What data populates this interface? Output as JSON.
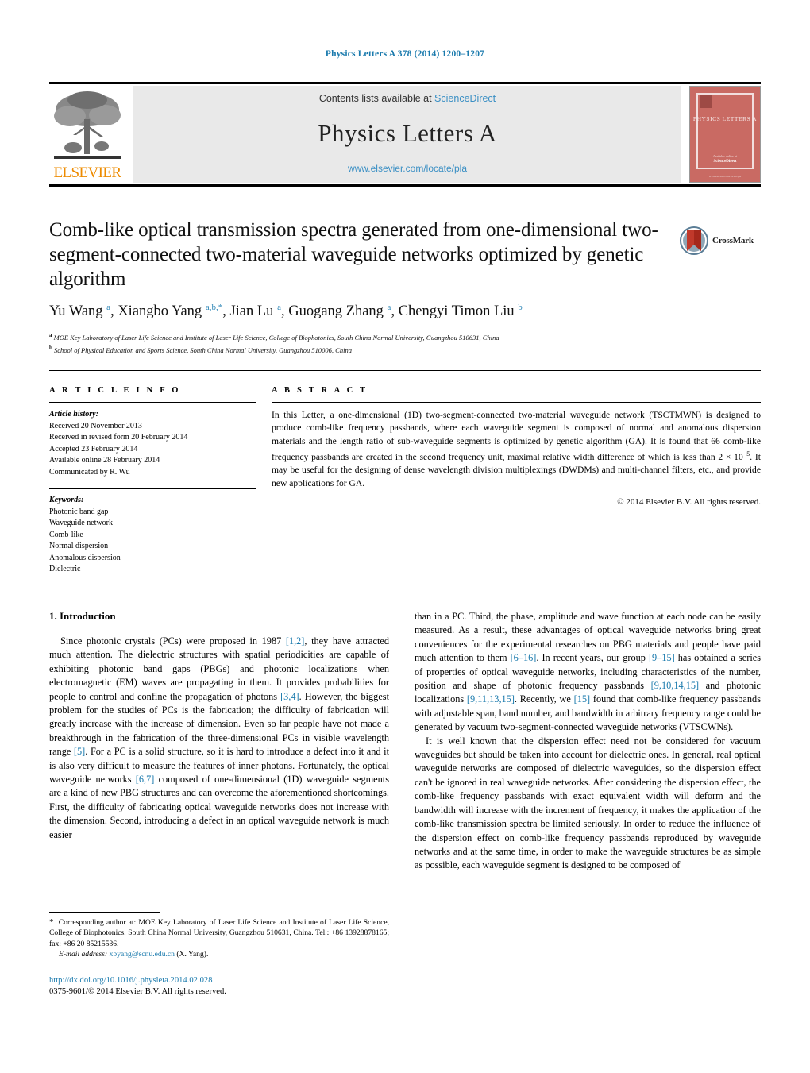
{
  "running_head": "Physics Letters A 378 (2014) 1200–1207",
  "masthead": {
    "contents_prefix": "Contents lists available at ",
    "sciencedirect": "ScienceDirect",
    "journal_title": "Physics Letters A",
    "journal_url": "www.elsevier.com/locate/pla",
    "publisher_wordmark": "ELSEVIER",
    "cover": {
      "title": "PHYSICS LETTERS A",
      "footer_line1": "Available online at",
      "footer_line2": "ScienceDirect",
      "footer_line3": "www.elsevier.com/locate/pla"
    }
  },
  "article": {
    "title": "Comb-like optical transmission spectra generated from one-dimensional two-segment-connected two-material waveguide networks optimized by genetic algorithm",
    "crossmark_label": "CrossMark",
    "authors_html": "Yu Wang <sup>a</sup>, Xiangbo Yang <sup>a,b,</sup><sup>*</sup>, Jian Lu <sup>a</sup>, Guogang Zhang <sup>a</sup>, Chengyi Timon Liu <sup>b</sup>",
    "affiliations": [
      {
        "marker": "a",
        "text": "MOE Key Laboratory of Laser Life Science and Institute of Laser Life Science, College of Biophotonics, South China Normal University, Guangzhou 510631, China"
      },
      {
        "marker": "b",
        "text": "School of Physical Education and Sports Science, South China Normal University, Guangzhou 510006, China"
      }
    ]
  },
  "article_info": {
    "heading": "A R T I C L E   I N F O",
    "history_label": "Article history:",
    "history": [
      "Received 20 November 2013",
      "Received in revised form 20 February 2014",
      "Accepted 23 February 2014",
      "Available online 28 February 2014",
      "Communicated by R. Wu"
    ],
    "keywords_label": "Keywords:",
    "keywords": [
      "Photonic band gap",
      "Waveguide network",
      "Comb-like",
      "Normal dispersion",
      "Anomalous dispersion",
      "Dielectric"
    ]
  },
  "abstract": {
    "heading": "A B S T R A C T",
    "body_html": "In this Letter, a one-dimensional (1D) two-segment-connected two-material waveguide network (TSCTMWN) is designed to produce comb-like frequency passbands, where each waveguide segment is composed of normal and anomalous dispersion materials and the length ratio of sub-waveguide segments is optimized by genetic algorithm (GA). It is found that 66 comb-like frequency passbands are created in the second frequency unit, maximal relative width difference of which is less than 2 × 10<sup>−5</sup>. It may be useful for the designing of dense wavelength division multiplexings (DWDMs) and multi-channel filters, etc., and provide new applications for GA.",
    "copyright": "© 2014 Elsevier B.V. All rights reserved."
  },
  "body": {
    "section_heading": "1. Introduction",
    "left_paragraph_1_html": "Since photonic crystals (PCs) were proposed in 1987 <span class=\"ref\">[1,2]</span>, they have attracted much attention. The dielectric structures with spatial periodicities are capable of exhibiting photonic band gaps (PBGs) and photonic localizations when electromagnetic (EM) waves are propagating in them. It provides probabilities for people to control and confine the propagation of photons <span class=\"ref\">[3,4]</span>. However, the biggest problem for the studies of PCs is the fabrication; the difficulty of fabrication will greatly increase with the increase of dimension. Even so far people have not made a breakthrough in the fabrication of the three-dimensional PCs in visible wavelength range <span class=\"ref\">[5]</span>. For a PC is a solid structure, so it is hard to introduce a defect into it and it is also very difficult to measure the features of inner photons. Fortunately, the optical waveguide networks <span class=\"ref\">[6,7]</span> composed of one-dimensional (1D) waveguide segments are a kind of new PBG structures and can overcome the aforementioned shortcomings. First, the difficulty of fabricating optical waveguide networks does not increase with the dimension. Second, introducing a defect in an optical waveguide network is much easier",
    "right_paragraph_1_html": "than in a PC. Third, the phase, amplitude and wave function at each node can be easily measured. As a result, these advantages of optical waveguide networks bring great conveniences for the experimental researches on PBG materials and people have paid much attention to them <span class=\"ref\">[6–16]</span>. In recent years, our group <span class=\"ref\">[9–15]</span> has obtained a series of properties of optical waveguide networks, including characteristics of the number, position and shape of photonic frequency passbands <span class=\"ref\">[9,10,14,15]</span> and photonic localizations <span class=\"ref\">[9,11,13,15]</span>. Recently, we <span class=\"ref\">[15]</span> found that comb-like frequency passbands with adjustable span, band number, and bandwidth in arbitrary frequency range could be generated by vacuum two-segment-connected waveguide networks (VTSCWNs).",
    "right_paragraph_2_html": "It is well known that the dispersion effect need not be considered for vacuum waveguides but should be taken into account for dielectric ones. In general, real optical waveguide networks are composed of dielectric waveguides, so the dispersion effect can't be ignored in real waveguide networks. After considering the dispersion effect, the comb-like frequency passbands with exact equivalent width will deform and the bandwidth will increase with the increment of frequency, it makes the application of the comb-like transmission spectra be limited seriously. In order to reduce the influence of the dispersion effect on comb-like frequency passbands reproduced by waveguide networks and at the same time, in order to make the waveguide structures be as simple as possible, each waveguide segment is designed to be composed of"
  },
  "footnote": {
    "corresponding_html": "<span class=\"star\">*</span>&nbsp; Corresponding author at: MOE Key Laboratory of Laser Life Science and Institute of Laser Life Science, College of Biophotonics, South China Normal University, Guangzhou 510631, China. Tel.: +86 13928878165; fax: +86 20 85215536.",
    "email_label": "E-mail address:",
    "email": "xbyang@scnu.edu.cn",
    "email_owner": "(X. Yang).",
    "doi": "http://dx.doi.org/10.1016/j.physleta.2014.02.028",
    "issn_line": "0375-9601/© 2014 Elsevier B.V. All rights reserved."
  },
  "colors": {
    "link_blue": "#1a7aad",
    "sciencedirect_blue": "#3a8fc4",
    "elsevier_orange": "#ED8B00",
    "cover_red": "#c96a63"
  }
}
